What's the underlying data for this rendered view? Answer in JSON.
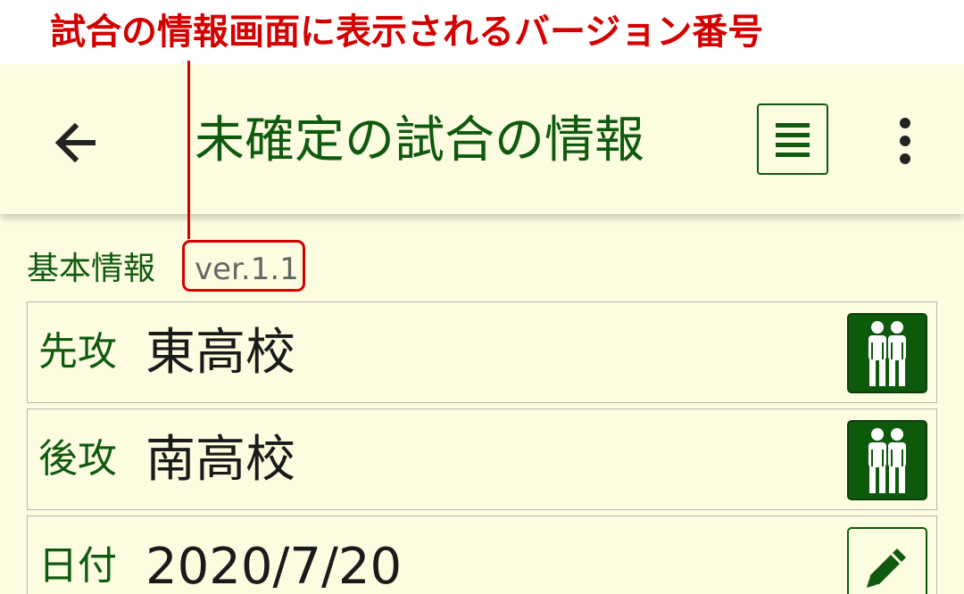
{
  "annotation": {
    "text": "試合の情報画面に表示されるバージョン番号",
    "color": "#d40000"
  },
  "toolbar": {
    "back_icon": "arrow-left-icon",
    "title": "未確定の試合の情報",
    "list_icon": "list-icon",
    "more_icon": "more-vertical-icon"
  },
  "section": {
    "label": "基本情報",
    "version": "ver.1.1"
  },
  "rows": [
    {
      "label": "先攻",
      "value": "東高校",
      "action_icon": "team-members-icon"
    },
    {
      "label": "後攻",
      "value": "南高校",
      "action_icon": "team-members-icon"
    },
    {
      "label": "日付",
      "value": "2020/7/20",
      "action_icon": "pencil-icon"
    }
  ],
  "colors": {
    "background": "#fcfce0",
    "accent": "#0f5a0f",
    "highlight": "#d40000"
  }
}
